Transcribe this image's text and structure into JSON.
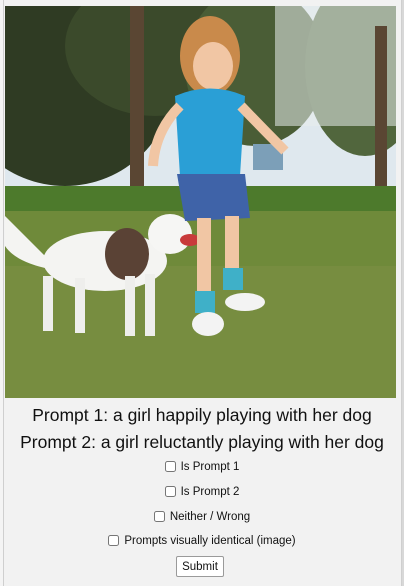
{
  "image": {
    "alt": "",
    "icon": "photo-icon"
  },
  "prompts": {
    "prompt1": "Prompt 1: a girl happily playing with her dog",
    "prompt2": "Prompt 2: a girl reluctantly playing with her dog"
  },
  "options": [
    {
      "label": "Is Prompt 1",
      "checked": false
    },
    {
      "label": "Is Prompt 2",
      "checked": false
    },
    {
      "label": "Neither / Wrong",
      "checked": false
    },
    {
      "label": "Prompts visually identical (image)",
      "checked": false
    }
  ],
  "submit_label": "Submit",
  "colors": {
    "panel_bg": "#f2f2f2",
    "grass": "#6f8a3a",
    "sky": "#dfe8ee",
    "shirt": "#2a9fd6",
    "skirt": "#3f63a8"
  }
}
